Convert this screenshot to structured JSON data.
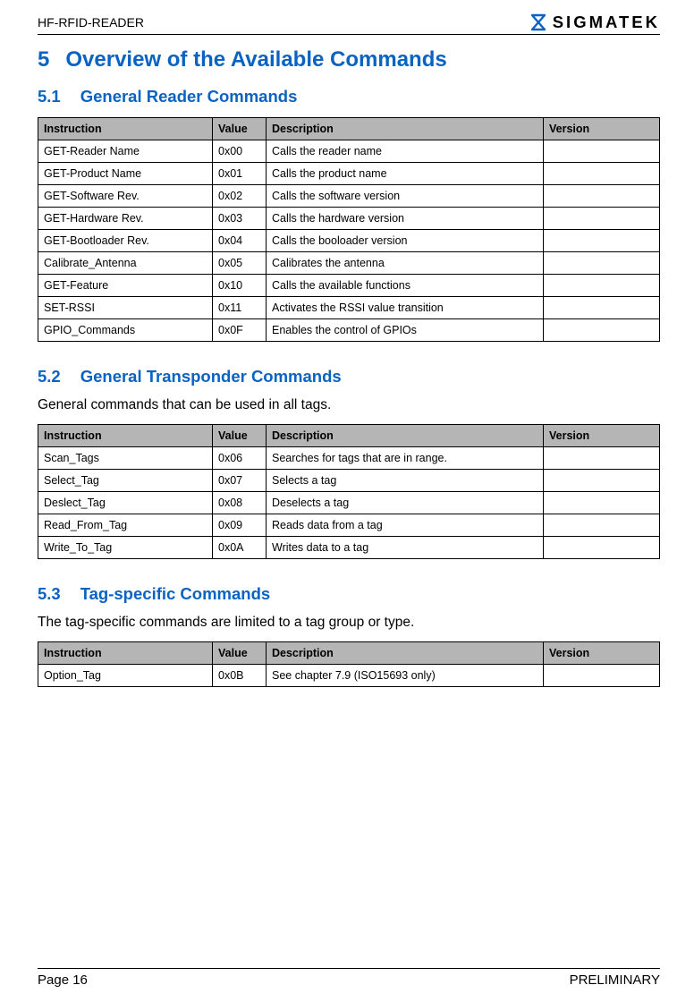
{
  "header": {
    "left": "HF-RFID-READER",
    "brand": "SIGMATEK"
  },
  "section": {
    "num": "5",
    "title": "Overview of the Available Commands"
  },
  "sub1": {
    "num": "5.1",
    "title": "General Reader Commands",
    "columns": {
      "c1": "Instruction",
      "c2": "Value",
      "c3": "Description",
      "c4": "Version"
    },
    "rows": [
      {
        "instr": "GET-Reader Name",
        "value": "0x00",
        "desc": "Calls the reader name",
        "ver": ""
      },
      {
        "instr": "GET-Product Name",
        "value": "0x01",
        "desc": "Calls the product name",
        "ver": ""
      },
      {
        "instr": "GET-Software Rev.",
        "value": "0x02",
        "desc": "Calls the software version",
        "ver": ""
      },
      {
        "instr": "GET-Hardware Rev.",
        "value": "0x03",
        "desc": "Calls the hardware version",
        "ver": ""
      },
      {
        "instr": "GET-Bootloader Rev.",
        "value": "0x04",
        "desc": "Calls the booloader version",
        "ver": ""
      },
      {
        "instr": "Calibrate_Antenna",
        "value": "0x05",
        "desc": "Calibrates the antenna",
        "ver": ""
      },
      {
        "instr": "GET-Feature",
        "value": "0x10",
        "desc": "Calls the available functions",
        "ver": ""
      },
      {
        "instr": "SET-RSSI",
        "value": "0x11",
        "desc": "Activates the RSSI value transition",
        "ver": ""
      },
      {
        "instr": "GPIO_Commands",
        "value": "0x0F",
        "desc": "Enables the control of GPIOs",
        "ver": ""
      }
    ]
  },
  "sub2": {
    "num": "5.2",
    "title": "General Transponder Commands",
    "intro": "General commands that can be used in all tags.",
    "columns": {
      "c1": "Instruction",
      "c2": "Value",
      "c3": "Description",
      "c4": "Version"
    },
    "rows": [
      {
        "instr": "Scan_Tags",
        "value": "0x06",
        "desc": "Searches for tags that are in range.",
        "ver": ""
      },
      {
        "instr": "Select_Tag",
        "value": "0x07",
        "desc": "Selects a tag",
        "ver": ""
      },
      {
        "instr": "Deslect_Tag",
        "value": "0x08",
        "desc": "Deselects a tag",
        "ver": ""
      },
      {
        "instr": "Read_From_Tag",
        "value": "0x09",
        "desc": "Reads data from a tag",
        "ver": ""
      },
      {
        "instr": "Write_To_Tag",
        "value": "0x0A",
        "desc": "Writes data to a tag",
        "ver": ""
      }
    ]
  },
  "sub3": {
    "num": "5.3",
    "title": "Tag-specific Commands",
    "intro": "The tag-specific commands are limited to a tag group or type.",
    "columns": {
      "c1": "Instruction",
      "c2": "Value",
      "c3": "Description",
      "c4": "Version"
    },
    "rows": [
      {
        "instr": "Option_Tag",
        "value": "0x0B",
        "desc": "See chapter 7.9 (ISO15693 only)",
        "ver": ""
      }
    ]
  },
  "footer": {
    "left": "Page 16",
    "right": "PRELIMINARY"
  }
}
